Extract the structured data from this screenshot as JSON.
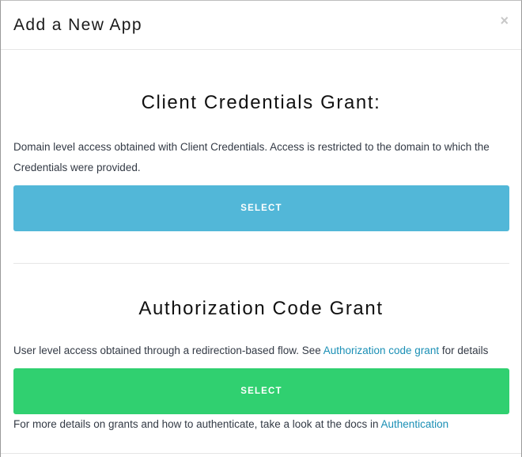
{
  "modal": {
    "title": "Add a New App",
    "close_label": "×"
  },
  "client_credentials": {
    "title": "Client Credentials Grant:",
    "description": "Domain level access obtained with Client Credentials. Access is restricted to the domain to which the Credentials were provided.",
    "button_label": "SELECT"
  },
  "authorization_code": {
    "title": "Authorization Code Grant",
    "description_prefix": "User level access obtained through a redirection-based flow. See ",
    "link_label": "Authorization code grant",
    "description_suffix": " for details",
    "button_label": "SELECT"
  },
  "footer": {
    "text_prefix": "For more details on grants and how to authenticate, take a look at the docs in ",
    "link_label": "Authentication"
  },
  "colors": {
    "client_button": "#52b7d8",
    "auth_button": "#30d070",
    "link": "#1a8fb5"
  },
  "icons": {
    "close": "close-icon"
  }
}
